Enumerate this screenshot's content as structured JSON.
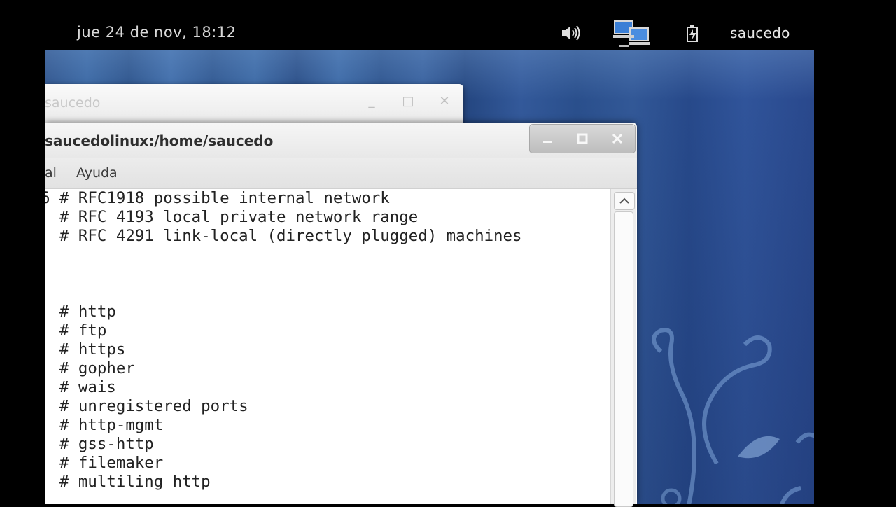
{
  "topbar": {
    "datetime": "jue 24 de nov, 18:12",
    "user": "saucedo",
    "icons": [
      "volume-icon",
      "network-icon",
      "battery-icon"
    ]
  },
  "back_window": {
    "title": "saucedo"
  },
  "terminal": {
    "title": "saucedolinux:/home/saucedo",
    "menu": [
      "al",
      "Ayuda"
    ],
    "lines": [
      "6 # RFC1918 possible internal network",
      "  # RFC 4193 local private network range",
      "  # RFC 4291 link-local (directly plugged) machines",
      "",
      "",
      "",
      "  # http",
      "  # ftp",
      "  # https",
      "  # gopher",
      "  # wais",
      "  # unregistered ports",
      "  # http-mgmt",
      "  # gss-http",
      "  # filemaker",
      "  # multiling http"
    ]
  },
  "colors": {
    "desktop": "#2f5795",
    "panel": "#000000",
    "window": "#ffffff"
  }
}
